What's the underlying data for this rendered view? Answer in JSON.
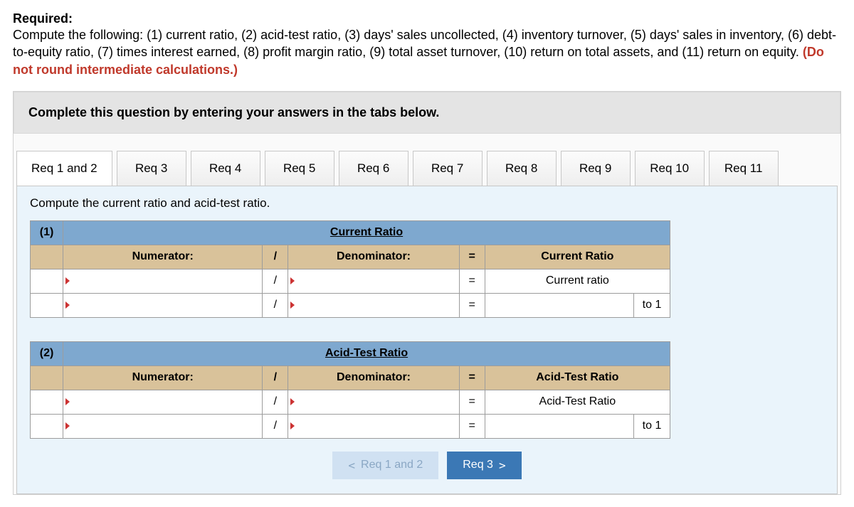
{
  "required": {
    "title": "Required:",
    "body_pre": "Compute the following: (1) current ratio, (2) acid-test ratio, (3) days' sales uncollected, (4) inventory turnover, (5) days' sales in inventory, (6) debt-to-equity ratio, (7) times interest earned, (8) profit margin ratio, (9) total asset turnover, (10) return on total assets, and (11) return on equity. ",
    "body_red": "(Do not round intermediate calculations.)"
  },
  "instruction": "Complete this question by entering your answers in the tabs below.",
  "tabs": [
    "Req 1 and 2",
    "Req 3",
    "Req 4",
    "Req 5",
    "Req 6",
    "Req 7",
    "Req 8",
    "Req 9",
    "Req 10",
    "Req 11"
  ],
  "tab_instruction": "Compute the current ratio and acid-test ratio.",
  "sections": [
    {
      "num": "(1)",
      "title": "Current Ratio",
      "numerator_label": "Numerator:",
      "denominator_label": "Denominator:",
      "result_header": "Current Ratio",
      "result_label": "Current ratio",
      "to1": "to 1"
    },
    {
      "num": "(2)",
      "title": "Acid-Test Ratio",
      "numerator_label": "Numerator:",
      "denominator_label": "Denominator:",
      "result_header": "Acid-Test Ratio",
      "result_label": "Acid-Test Ratio",
      "to1": "to 1"
    }
  ],
  "symbols": {
    "div": "/",
    "eq": "="
  },
  "nav": {
    "prev": "Req 1 and 2",
    "next": "Req 3"
  }
}
